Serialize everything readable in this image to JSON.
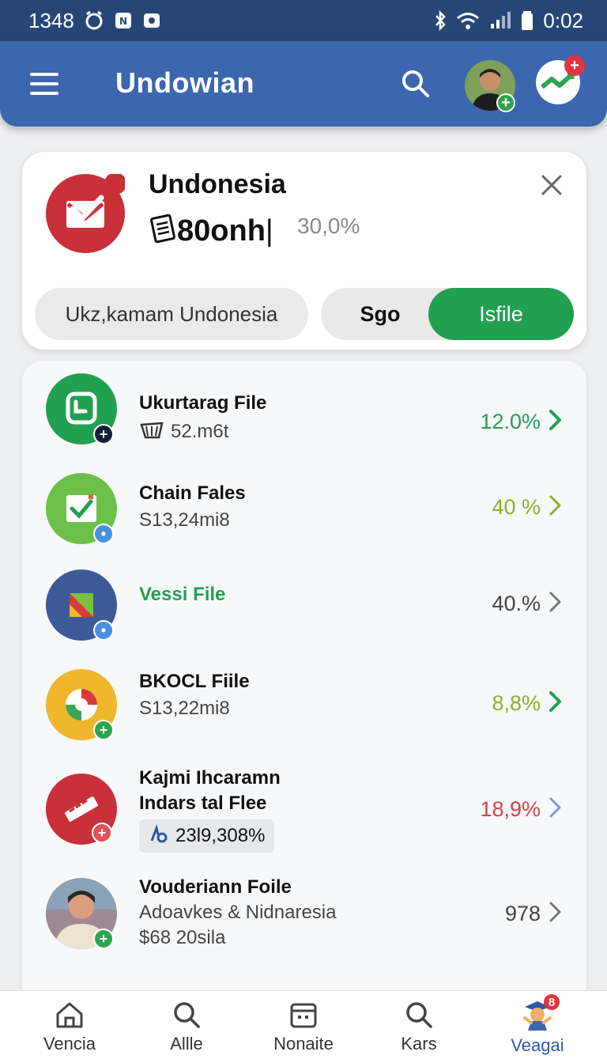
{
  "status_bar": {
    "time_left": "1348",
    "time_right": "0:02"
  },
  "app_bar": {
    "title": "Undowian",
    "notification_count": "+"
  },
  "summary": {
    "title": "Undonesia",
    "amount": "80onh",
    "amount_prefix_icon": "document-icon",
    "percent": "30,0%",
    "field_label": "Ukz,kamam Undonesia",
    "segment_a": "Sgo",
    "segment_b": "Isfile",
    "colors": {
      "accent_green": "#22a052",
      "brand_red": "#c9303a"
    }
  },
  "list": [
    {
      "title": "Ukurtarag File",
      "subtitle": "52.m6t",
      "value": "12.0%",
      "value_color": "#22a052",
      "chevron_color": "#22a052",
      "icon": "clock-doc-icon"
    },
    {
      "title": "Chain Fales",
      "subtitle": "S13,24mi8",
      "value": "40 %",
      "value_color": "#8fb02b",
      "chevron_color": "#8fb02b",
      "icon": "checkbox-icon"
    },
    {
      "title": "Vessi File",
      "subtitle": "",
      "value": "40.%",
      "value_color": "#444444",
      "chevron_color": "#777777",
      "icon": "cube-icon"
    },
    {
      "title": "BKOCL Fiile",
      "subtitle": "S13,22mi8",
      "value": "8,8%",
      "value_color": "#8fb02b",
      "chevron_color": "#22a052",
      "icon": "swirl-icon"
    },
    {
      "title_line1": "Kajmi Ihcaramn",
      "title_line2": "Indars tal Flee",
      "tag": "23l9,308%",
      "value": "18,9%",
      "value_color": "#d5404a",
      "chevron_color": "#7a9cd9",
      "icon": "pencil-icon"
    },
    {
      "title": "Vouderiann Foile",
      "subtitle": "Adoavkes & Nidnaresia",
      "subtitle2": "$68 20sila",
      "value": "978",
      "value_color": "#444444",
      "chevron_color": "#777777",
      "icon": "person-avatar"
    }
  ],
  "bottom_nav": [
    {
      "label": "Vencia",
      "icon": "home-icon"
    },
    {
      "label": "Allle",
      "icon": "search-icon"
    },
    {
      "label": "Nonaite",
      "icon": "calendar-icon"
    },
    {
      "label": "Kars",
      "icon": "search-icon"
    },
    {
      "label": "Veagai",
      "icon": "mascot-icon",
      "badge": "8",
      "active": true
    }
  ]
}
